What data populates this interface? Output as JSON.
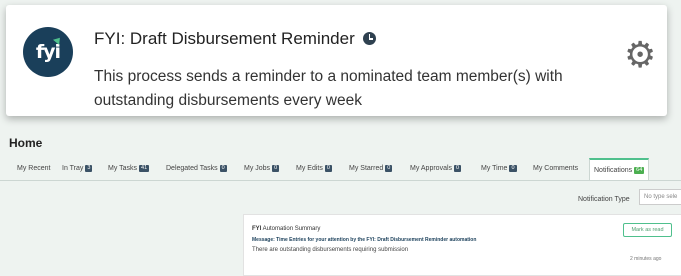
{
  "card": {
    "logo_text": "fyi",
    "title": "FYI: Draft Disbursement Reminder",
    "description": "This process sends a reminder to a nominated team member(s) with outstanding disbursements every week",
    "icons": {
      "clock": "clock-icon",
      "settings": "gear-icon"
    }
  },
  "app": {
    "page_title": "Home",
    "tabs": [
      {
        "label": "My Recent"
      },
      {
        "label": "In Tray",
        "badge": "3"
      },
      {
        "label": "My Tasks",
        "badge": "41"
      },
      {
        "label": "Delegated Tasks",
        "badge": "0"
      },
      {
        "label": "My Jobs",
        "badge": "0"
      },
      {
        "label": "My Edits",
        "badge": "0"
      },
      {
        "label": "My Starred",
        "badge": "0"
      },
      {
        "label": "My Approvals",
        "badge": "0"
      },
      {
        "label": "My Time",
        "badge": "0"
      },
      {
        "label": "My Comments"
      },
      {
        "label": "Notifications",
        "badge": "64",
        "active": true
      }
    ],
    "notification_type": {
      "label": "Notification Type",
      "placeholder": "No type sele"
    },
    "notification": {
      "title_bold": "FYI",
      "title_rest": " Automation Summary",
      "message_label": "Message:",
      "message": " Time Entries for your attention by the FYI: Draft Disbursement Reminder automation",
      "body": "There are outstanding disbursements requiring submission",
      "mark_read": "Mark as read",
      "time": "2 minutes ago"
    }
  },
  "colors": {
    "accent": "#4fc08d",
    "brand": "#1a3f5a",
    "badge": "#3b5266"
  }
}
